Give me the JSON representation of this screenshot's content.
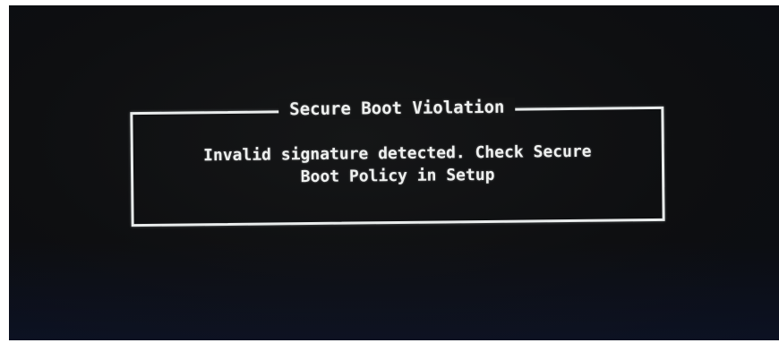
{
  "dialog": {
    "title": "Secure Boot Violation",
    "message_line1": "Invalid signature detected. Check Secure",
    "message_line2": "Boot Policy in Setup"
  }
}
